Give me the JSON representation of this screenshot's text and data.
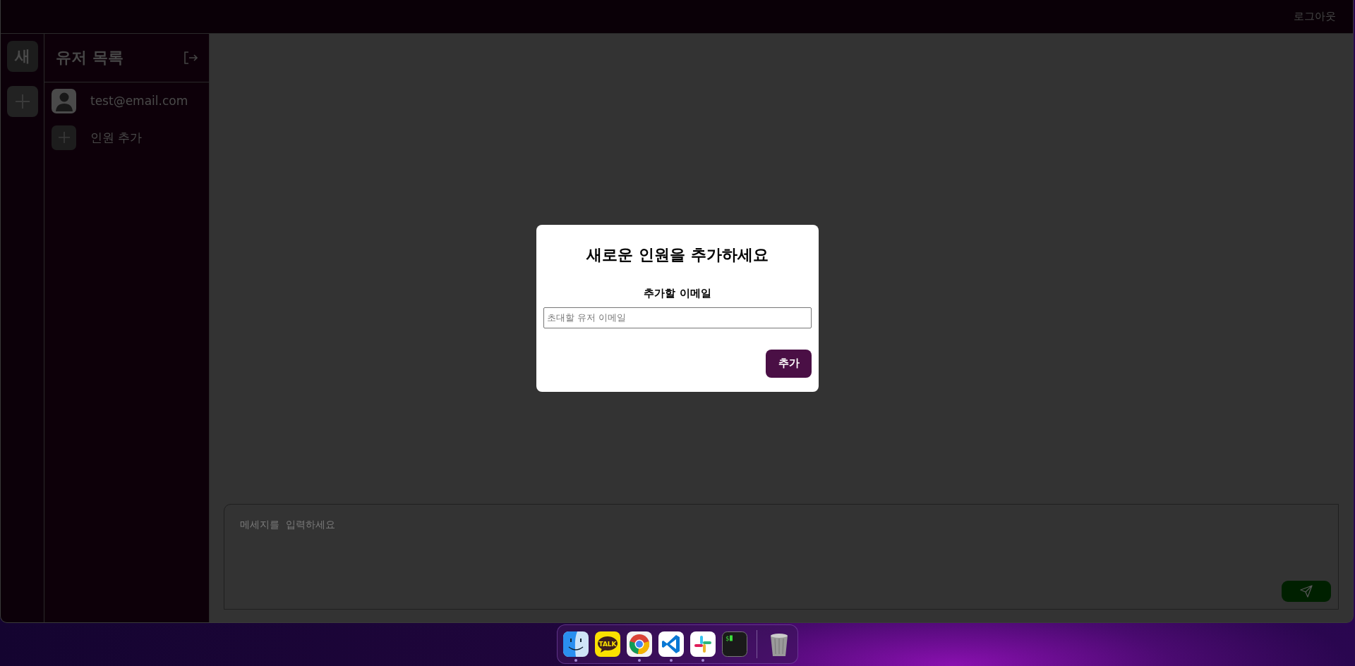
{
  "top_bar": {
    "logout": "로그아웃"
  },
  "rail": {
    "items": [
      {
        "kind": "workspace",
        "label": "새"
      },
      {
        "kind": "add"
      }
    ]
  },
  "sidebar": {
    "title": "유저 목록",
    "users": [
      {
        "kind": "user",
        "label": "test@email.com"
      },
      {
        "kind": "add",
        "label": "인원 추가"
      }
    ]
  },
  "composer": {
    "placeholder": "메세지를  입력하세요"
  },
  "modal": {
    "title": "새로운 인원을 추가하세요",
    "field_label": "추가할 이메일",
    "placeholder": "초대할 유저 이메일",
    "button": "추가"
  },
  "dock": [
    {
      "kind": "finder",
      "running": true
    },
    {
      "kind": "kakaotalk",
      "text": "TALK",
      "running": false
    },
    {
      "kind": "chrome",
      "running": true
    },
    {
      "kind": "vscode",
      "running": true
    },
    {
      "kind": "slack",
      "running": true
    },
    {
      "kind": "terminal",
      "text": "$",
      "running": false
    },
    {
      "kind": "separator"
    },
    {
      "kind": "trash",
      "running": false
    }
  ]
}
